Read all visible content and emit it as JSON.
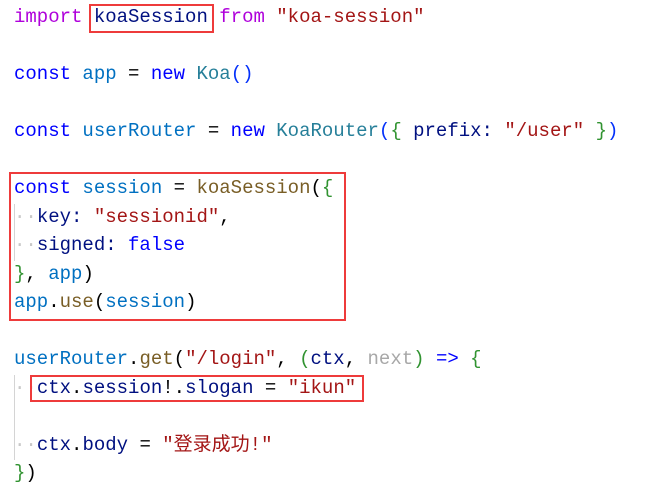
{
  "code": {
    "lines": [
      {
        "tokens": [
          {
            "t": "import ",
            "c": "kw"
          },
          {
            "t": "koaSession",
            "c": "var"
          },
          {
            "t": " from ",
            "c": "kw"
          },
          {
            "t": "\"koa-session\"",
            "c": "str"
          }
        ]
      },
      {
        "tokens": []
      },
      {
        "tokens": [
          {
            "t": "const ",
            "c": "st"
          },
          {
            "t": "app",
            "c": "cv"
          },
          {
            "t": " = ",
            "c": "op"
          },
          {
            "t": "new ",
            "c": "st"
          },
          {
            "t": "Koa",
            "c": "cls"
          },
          {
            "t": "()",
            "c": "br2"
          }
        ]
      },
      {
        "tokens": []
      },
      {
        "tokens": [
          {
            "t": "const ",
            "c": "st"
          },
          {
            "t": "userRouter",
            "c": "cv"
          },
          {
            "t": " = ",
            "c": "op"
          },
          {
            "t": "new ",
            "c": "st"
          },
          {
            "t": "KoaRouter",
            "c": "cls"
          },
          {
            "t": "(",
            "c": "br2"
          },
          {
            "t": "{",
            "c": "br1"
          },
          {
            "t": " prefix: ",
            "c": "var"
          },
          {
            "t": "\"/user\"",
            "c": "str"
          },
          {
            "t": " ",
            "c": "op"
          },
          {
            "t": "}",
            "c": "br1"
          },
          {
            "t": ")",
            "c": "br2"
          }
        ]
      },
      {
        "tokens": []
      },
      {
        "tokens": [
          {
            "t": "const ",
            "c": "st"
          },
          {
            "t": "session",
            "c": "cv"
          },
          {
            "t": " = ",
            "c": "op"
          },
          {
            "t": "koaSession",
            "c": "fn"
          },
          {
            "t": "(",
            "c": "br0"
          },
          {
            "t": "{",
            "c": "br1"
          }
        ]
      },
      {
        "tokens": [
          {
            "t": "··",
            "c": "ws"
          },
          {
            "t": "key: ",
            "c": "var"
          },
          {
            "t": "\"sessionid\"",
            "c": "str"
          },
          {
            "t": ",",
            "c": "op"
          }
        ]
      },
      {
        "tokens": [
          {
            "t": "··",
            "c": "ws"
          },
          {
            "t": "signed: ",
            "c": "var"
          },
          {
            "t": "false",
            "c": "st"
          }
        ]
      },
      {
        "tokens": [
          {
            "t": "}",
            "c": "br1"
          },
          {
            "t": ", ",
            "c": "op"
          },
          {
            "t": "app",
            "c": "cv"
          },
          {
            "t": ")",
            "c": "br0"
          }
        ]
      },
      {
        "tokens": [
          {
            "t": "app",
            "c": "cv"
          },
          {
            "t": ".",
            "c": "op"
          },
          {
            "t": "use",
            "c": "fn"
          },
          {
            "t": "(",
            "c": "br0"
          },
          {
            "t": "session",
            "c": "cv"
          },
          {
            "t": ")",
            "c": "br0"
          }
        ]
      },
      {
        "tokens": []
      },
      {
        "tokens": [
          {
            "t": "userRouter",
            "c": "cv"
          },
          {
            "t": ".",
            "c": "op"
          },
          {
            "t": "get",
            "c": "fn"
          },
          {
            "t": "(",
            "c": "br0"
          },
          {
            "t": "\"/login\"",
            "c": "str"
          },
          {
            "t": ", ",
            "c": "op"
          },
          {
            "t": "(",
            "c": "br1"
          },
          {
            "t": "ctx",
            "c": "var"
          },
          {
            "t": ", ",
            "c": "op"
          },
          {
            "t": "next",
            "c": "un"
          },
          {
            "t": ")",
            "c": "br1"
          },
          {
            "t": " ",
            "c": "op"
          },
          {
            "t": "=>",
            "c": "st"
          },
          {
            "t": " ",
            "c": "op"
          },
          {
            "t": "{",
            "c": "br1"
          }
        ]
      },
      {
        "tokens": [
          {
            "t": "··",
            "c": "ws"
          },
          {
            "t": "ctx",
            "c": "var"
          },
          {
            "t": ".",
            "c": "op"
          },
          {
            "t": "session",
            "c": "var"
          },
          {
            "t": "!.",
            "c": "op"
          },
          {
            "t": "slogan",
            "c": "var"
          },
          {
            "t": " = ",
            "c": "op"
          },
          {
            "t": "\"ikun\"",
            "c": "str"
          }
        ]
      },
      {
        "tokens": []
      },
      {
        "tokens": [
          {
            "t": "··",
            "c": "ws"
          },
          {
            "t": "ctx",
            "c": "var"
          },
          {
            "t": ".",
            "c": "op"
          },
          {
            "t": "body",
            "c": "var"
          },
          {
            "t": " = ",
            "c": "op"
          },
          {
            "t": "\"登录成功!\"",
            "c": "str"
          }
        ]
      },
      {
        "tokens": [
          {
            "t": "}",
            "c": "br1"
          },
          {
            "t": ")",
            "c": "br0"
          }
        ]
      }
    ]
  }
}
